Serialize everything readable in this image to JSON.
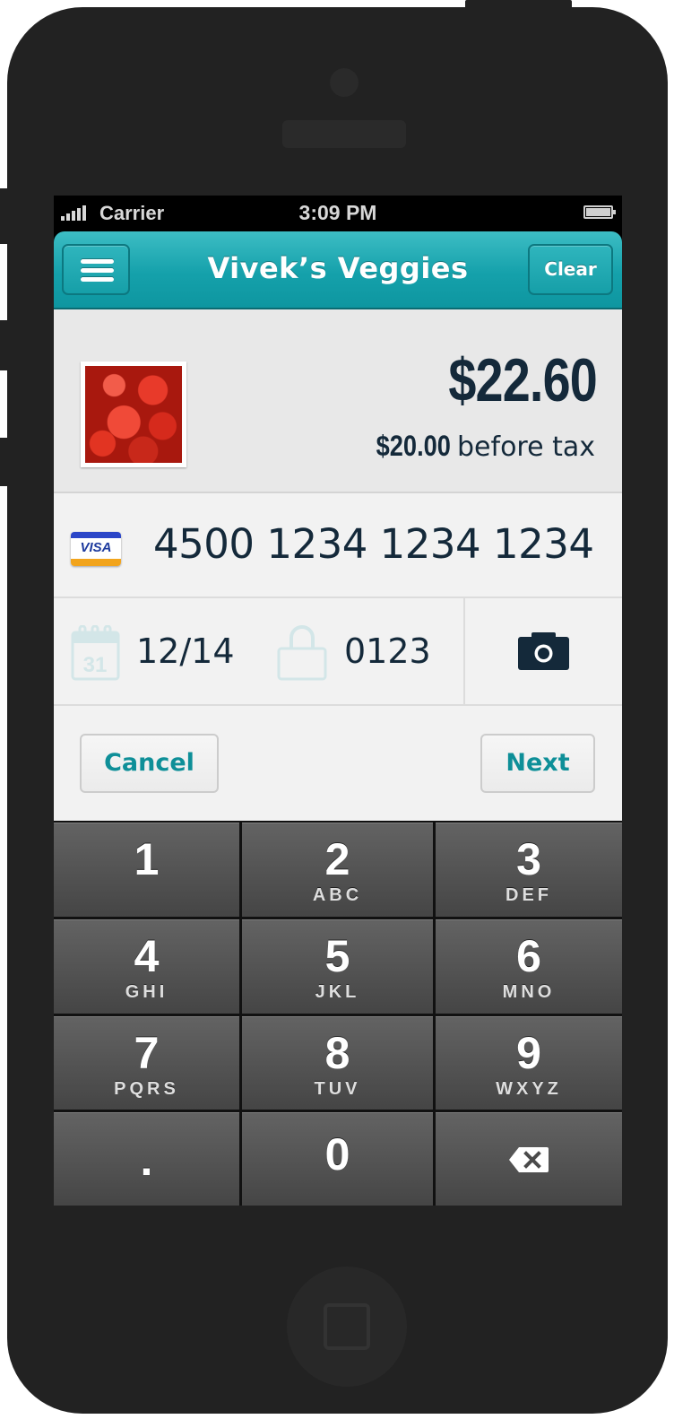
{
  "status_bar": {
    "carrier": "Carrier",
    "time": "3:09 PM",
    "signal_icon": "signal-bars-icon",
    "battery_icon": "battery-icon"
  },
  "nav": {
    "title": "Vivek’s Veggies",
    "menu_icon": "hamburger-menu-icon",
    "clear_label": "Clear"
  },
  "summary": {
    "total": "$22.60",
    "subtotal": "$20.00",
    "subtotal_suffix": " before tax",
    "thumbnail": "tomatoes-image"
  },
  "card": {
    "brand_label": "VISA",
    "number": "4500 1234 1234 1234",
    "expiry": "12/14",
    "expiry_icon_day": "31",
    "cvv": "0123"
  },
  "actions": {
    "cancel_label": "Cancel",
    "next_label": "Next"
  },
  "keypad": {
    "keys": [
      {
        "num": "1",
        "letters": ""
      },
      {
        "num": "2",
        "letters": "ABC"
      },
      {
        "num": "3",
        "letters": "DEF"
      },
      {
        "num": "4",
        "letters": "GHI"
      },
      {
        "num": "5",
        "letters": "JKL"
      },
      {
        "num": "6",
        "letters": "MNO"
      },
      {
        "num": "7",
        "letters": "PQRS"
      },
      {
        "num": "8",
        "letters": "TUV"
      },
      {
        "num": "9",
        "letters": "WXYZ"
      },
      {
        "num": ".",
        "letters": ""
      },
      {
        "num": "0",
        "letters": ""
      },
      {
        "num": "",
        "letters": ""
      }
    ],
    "delete_icon": "backspace-icon"
  },
  "colors": {
    "accent": "#15a1ab",
    "text_dark": "#14293a",
    "button_text": "#0e8f98"
  }
}
